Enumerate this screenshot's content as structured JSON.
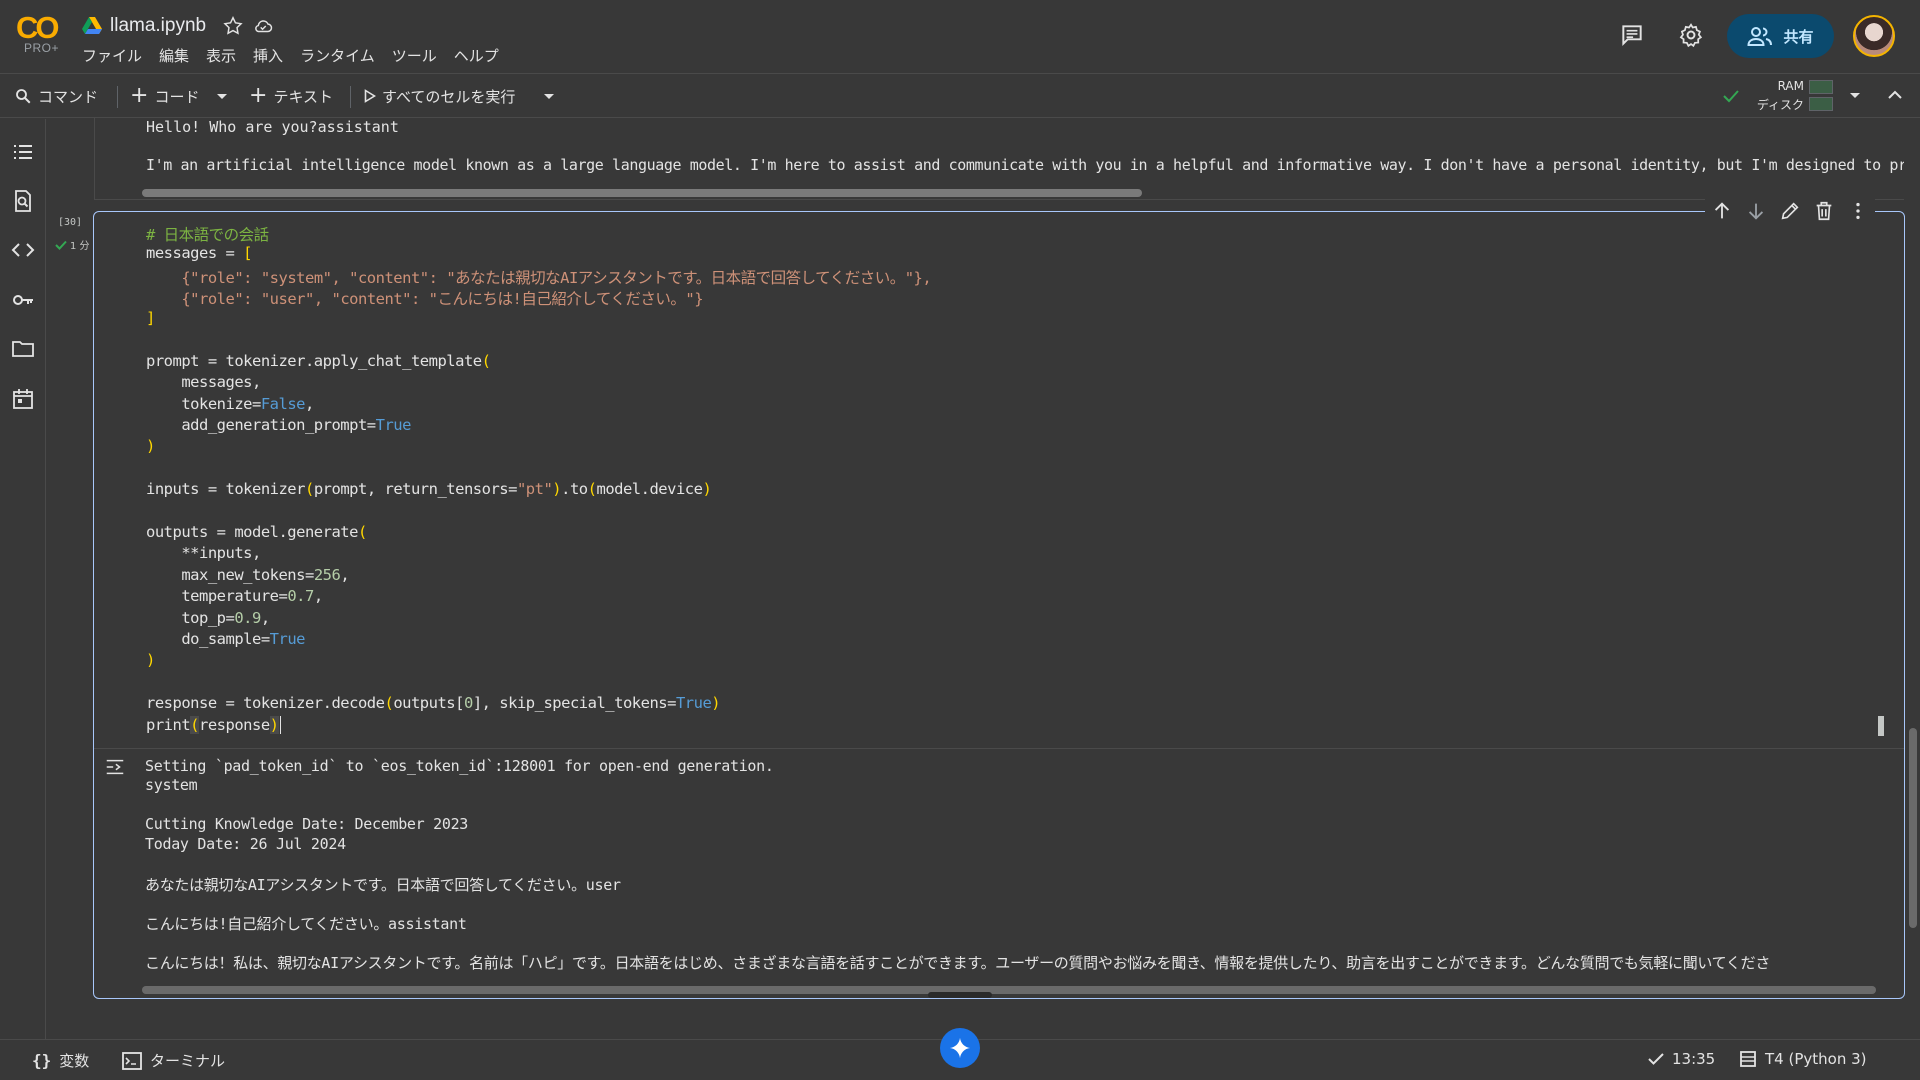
{
  "header": {
    "logo_text": "CO",
    "logo_sub": "PRO+",
    "doc_title": "llama.ipynb",
    "menu": [
      "ファイル",
      "編集",
      "表示",
      "挿入",
      "ランタイム",
      "ツール",
      "ヘルプ"
    ],
    "share_label": "共有"
  },
  "toolbar": {
    "command": "コマンド",
    "code": "コード",
    "text": "テキスト",
    "run_all": "すべてのセルを実行",
    "ram": "RAM",
    "disk": "ディスク"
  },
  "prev_output": {
    "line1": "Hello! Who are you?assistant",
    "line2": "I'm an artificial intelligence model known as a large language model. I'm here to assist and communicate with you in a helpful and informative way. I don't have a personal identity, but I'm designed to provide knowledge and"
  },
  "cell": {
    "exec_count": "[30]",
    "exec_time": "1 分",
    "code": {
      "l1": "# 日本語での会話",
      "l2a": "messages = ",
      "l2b": "[",
      "l3a": "    {\"role\": ",
      "l3b": "\"system\"",
      "l3c": ", \"content\": ",
      "l3d": "\"あなたは親切なAIアシスタントです。日本語で回答してください。\"",
      "l3e": "},",
      "l4a": "    {\"role\": ",
      "l4b": "\"user\"",
      "l4c": ", \"content\": ",
      "l4d": "\"こんにちは!自己紹介してください。\"",
      "l4e": "}",
      "l5": "]",
      "l7a": "prompt = tokenizer.apply_chat_template",
      "l7b": "(",
      "l8": "    messages,",
      "l9a": "    tokenize=",
      "l9b": "False",
      "l9c": ",",
      "l10a": "    add_generation_prompt=",
      "l10b": "True",
      "l11": ")",
      "l13a": "inputs = tokenizer",
      "l13b": "(",
      "l13c": "prompt, return_tensors=",
      "l13d": "\"pt\"",
      "l13e": ")",
      "l13f": ".to",
      "l13g": "(",
      "l13h": "model.device",
      "l13i": ")",
      "l15a": "outputs = model.generate",
      "l15b": "(",
      "l16": "    **inputs,",
      "l17a": "    max_new_tokens=",
      "l17b": "256",
      "l17c": ",",
      "l18a": "    temperature=",
      "l18b": "0.7",
      "l18c": ",",
      "l19a": "    top_p=",
      "l19b": "0.9",
      "l19c": ",",
      "l20a": "    do_sample=",
      "l20b": "True",
      "l21": ")",
      "l23a": "response = tokenizer.decode",
      "l23b": "(",
      "l23c": "outputs[",
      "l23d": "0",
      "l23e": "], skip_special_tokens=",
      "l23f": "True",
      "l23g": ")",
      "l24a": "print",
      "l24b": "(",
      "l24c": "response",
      "l24d": ")"
    },
    "output": [
      "Setting `pad_token_id` to `eos_token_id`:128001 for open-end generation.",
      "system",
      "Cutting Knowledge Date: December 2023",
      "Today Date: 26 Jul 2024",
      "あなたは親切なAIアシスタントです。日本語で回答してください。user",
      "こんにちは!自己紹介してください。assistant",
      "こんにちは！私は、親切なAIアシスタントです。名前は「ハピ」です。日本語をはじめ、さまざまな言語を話すことができます。ユーザーの質問やお悩みを聞き、情報を提供したり、助言を出すことができます。どんな質問でも気軽に聞いてくださ"
    ]
  },
  "statusbar": {
    "variables": "変数",
    "terminal": "ターミナル",
    "time": "13:35",
    "runtime": "T4 (Python 3)"
  }
}
